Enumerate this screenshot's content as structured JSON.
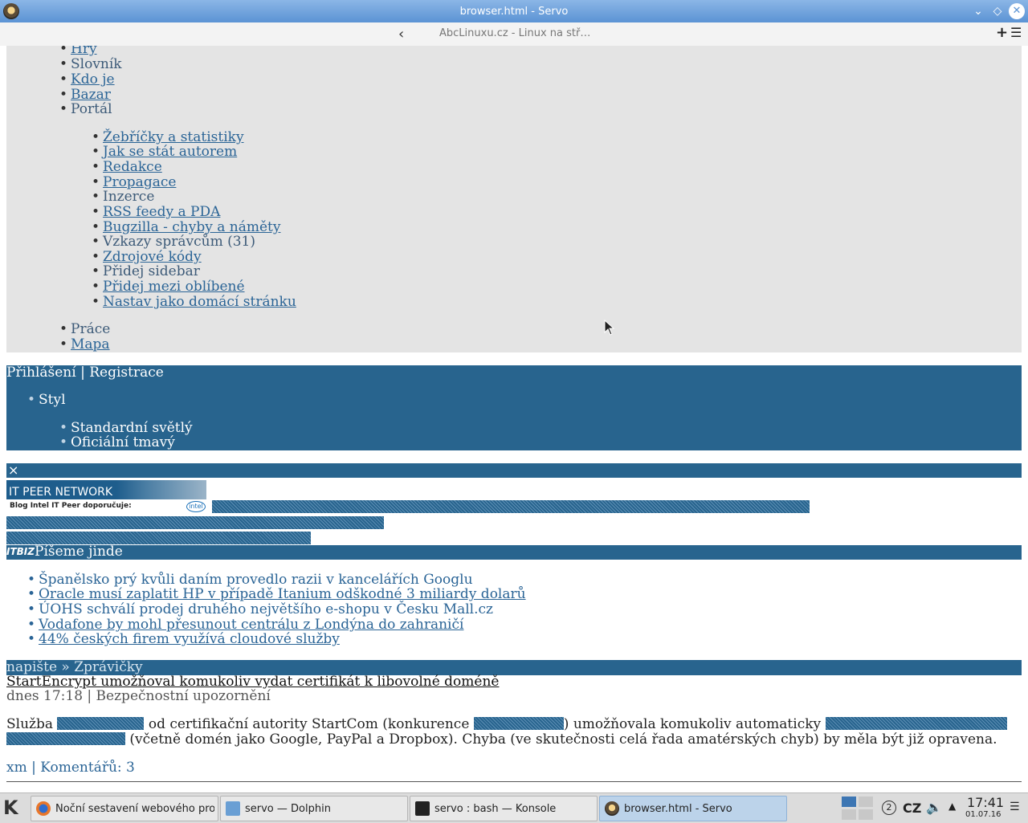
{
  "window": {
    "title": "browser.html - Servo"
  },
  "toolbar": {
    "url_text": "AbcLinuxu.cz - Linux na stř…"
  },
  "nav_top": [
    "Hry",
    "Slovník",
    "Kdo je",
    "Bazar",
    "Portál"
  ],
  "portal_items": [
    "Žebříčky a statistiky",
    "Jak se stát autorem",
    "Redakce",
    "Propagace",
    "Inzerce",
    "RSS feedy a PDA",
    "Bugzilla - chyby a náměty",
    "Vzkazy správcům (31)",
    "Zdrojové kódy",
    "Přidej sidebar",
    "Přidej mezi oblíbené",
    "Nastav jako domácí stránku"
  ],
  "nav_bottom": [
    "Práce",
    "Mapa"
  ],
  "user_bar": {
    "login": "Přihlášení",
    "separator": "|",
    "register": "Registrace"
  },
  "style_menu": {
    "label": "Styl",
    "options": [
      "Standardní světlý",
      "Oficiální tmavý"
    ]
  },
  "ad": {
    "close": "×",
    "banner_title": "IT PEER NETWORK",
    "banner_sub": "Blog Intel IT Peer doporučuje:",
    "banner_logo": "intel"
  },
  "itbiz": {
    "logo": "ITBIZ",
    "heading": "Píšeme jinde",
    "items": [
      "Španělsko prý kvůli daním provedlo razii v kancelářích Googlu",
      "Oracle musí zaplatit HP v případě Itanium odškodné 3 miliardy dolarů",
      "ÚOHS schválí prodej druhého největšího e-shopu v Česku Mall.cz",
      "Vodafone by mohl přesunout centrálu z Londýna do zahraničí",
      "44% českých firem využívá cloudové služby"
    ]
  },
  "news": {
    "crumb": "napište » Zprávičky",
    "title": "StartEncrypt umožňoval komukoliv vydat certifikát k libovolné doméně",
    "meta": "dnes 17:18 | Bezpečnostní upozornění",
    "p1": "Služba",
    "p2": "od certifikační autority StartCom (konkurence",
    "p3": ") umožňovala komukoliv automaticky",
    "p4": "(včetně domén jako Google, PayPal a Dropbox). Chyba (ve skutečnosti celá řada amatérských chyb) by měla být již opravena.",
    "author": "xm",
    "sep": "|",
    "comments": "Komentářů: 3"
  },
  "taskbar": {
    "tasks": [
      "Noční sestavení webového prohl",
      "servo — Dolphin",
      "servo : bash — Konsole",
      "browser.html - Servo"
    ],
    "tray_badge": "2",
    "keyboard_layout": "CZ",
    "time": "17:41",
    "date": "01.07.16"
  },
  "colors": {
    "accent_blue": "#28648e",
    "link": "#2a6496",
    "titlebar": "#5b93d4"
  }
}
